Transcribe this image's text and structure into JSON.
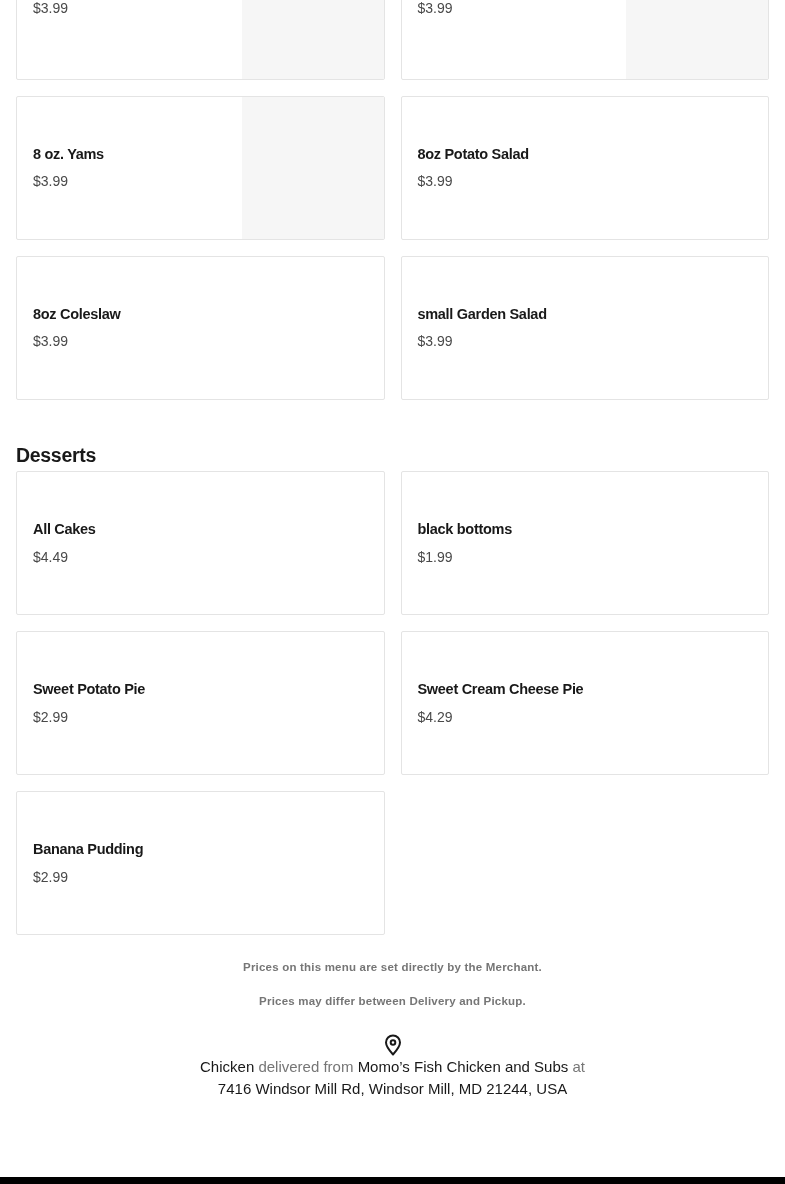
{
  "sections": [
    {
      "items": [
        {
          "price": "$3.99",
          "kind": "with_image"
        },
        {
          "price": "$3.99",
          "kind": "with_image"
        },
        {
          "name": "8 oz. Yams",
          "price": "$3.99",
          "kind": "with_image"
        },
        {
          "name": "8oz Potato Salad",
          "price": "$3.99",
          "kind": "text_only"
        },
        {
          "name": "8oz Coleslaw",
          "price": "$3.99",
          "kind": "text_only"
        },
        {
          "name": "small Garden Salad",
          "price": "$3.99",
          "kind": "text_only"
        }
      ]
    },
    {
      "title": "Desserts",
      "items": [
        {
          "name": "All Cakes",
          "price": "$4.49",
          "kind": "text_only"
        },
        {
          "name": "black bottoms",
          "price": "$1.99",
          "kind": "text_only"
        },
        {
          "name": "Sweet Potato Pie",
          "price": "$2.99",
          "kind": "text_only"
        },
        {
          "name": "Sweet Cream Cheese Pie",
          "price": "$4.29",
          "kind": "text_only"
        },
        {
          "name": "Banana Pudding",
          "price": "$2.99",
          "kind": "text_only"
        }
      ]
    }
  ],
  "notes": [
    "Prices on this menu are set directly by the Merchant.",
    "Prices may differ between Delivery and Pickup."
  ],
  "location": {
    "parts": [
      {
        "text": "Chicken",
        "muted": false
      },
      {
        "text": "delivered from",
        "muted": true
      },
      {
        "text": "Momo’s Fish Chicken and Subs",
        "muted": false
      },
      {
        "text": "at",
        "muted": true
      },
      {
        "text": "7416 Windsor Mill Rd, Windsor Mill, MD 21244, USA",
        "muted": false,
        "new_line": true
      }
    ]
  }
}
